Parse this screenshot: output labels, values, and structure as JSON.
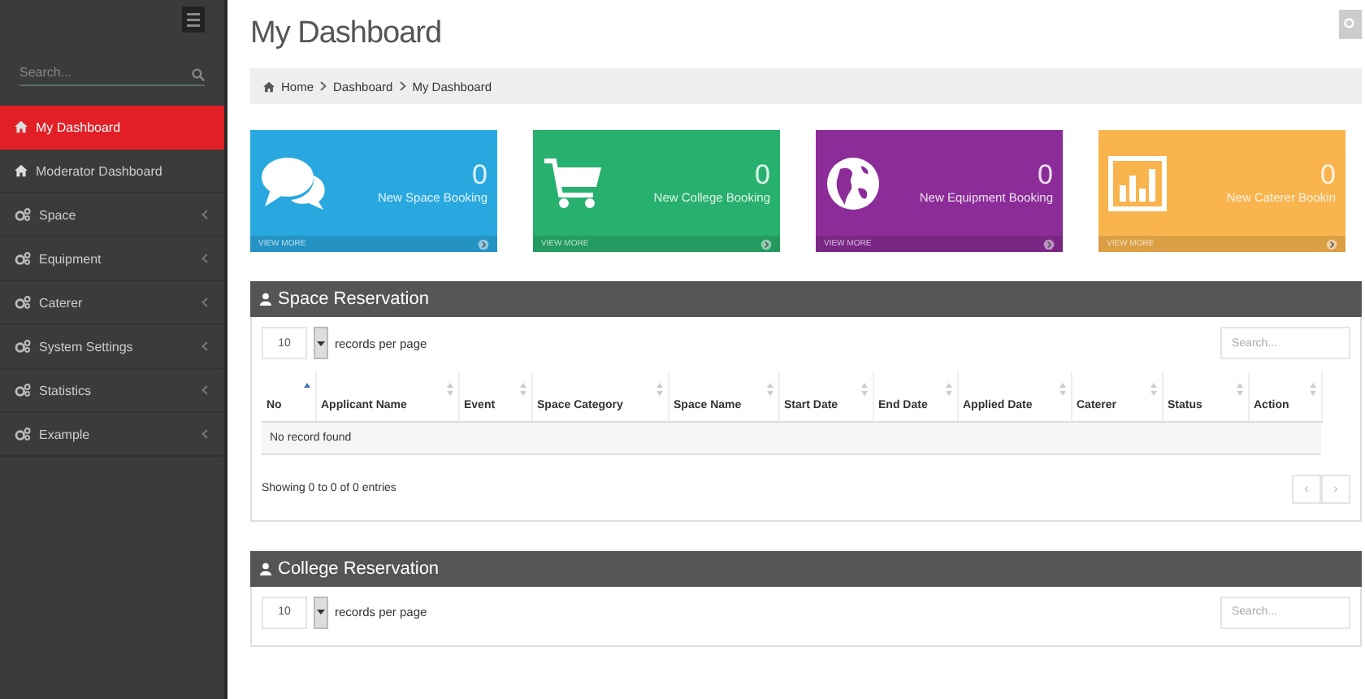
{
  "sidebar": {
    "search_placeholder": "Search...",
    "items": [
      {
        "label": "My Dashboard",
        "kind": "home",
        "selected": true,
        "expandable": false
      },
      {
        "label": "Moderator Dashboard",
        "kind": "home",
        "selected": false,
        "expandable": false
      },
      {
        "label": "Space",
        "kind": "group",
        "selected": false,
        "expandable": true
      },
      {
        "label": "Equipment",
        "kind": "group",
        "selected": false,
        "expandable": true
      },
      {
        "label": "Caterer",
        "kind": "group",
        "selected": false,
        "expandable": true
      },
      {
        "label": "System Settings",
        "kind": "group",
        "selected": false,
        "expandable": true
      },
      {
        "label": "Statistics",
        "kind": "group",
        "selected": false,
        "expandable": true
      },
      {
        "label": "Example",
        "kind": "group",
        "selected": false,
        "expandable": true
      }
    ]
  },
  "page": {
    "title": "My Dashboard",
    "breadcrumb": [
      "Home",
      "Dashboard",
      "My Dashboard"
    ]
  },
  "cards": [
    {
      "kind": "chat",
      "count": "0",
      "label": "New Space Booking",
      "footer": "VIEW MORE",
      "color": "#29a8e0"
    },
    {
      "kind": "cart",
      "count": "0",
      "label": "New College Booking",
      "footer": "VIEW MORE",
      "color": "#27b06e"
    },
    {
      "kind": "globe",
      "count": "0",
      "label": "New Equipment Booking",
      "footer": "VIEW MORE",
      "color": "#8b2c98"
    },
    {
      "kind": "chart",
      "count": "0",
      "label": "New Caterer Bookin",
      "footer": "VIEW MORE",
      "color": "#f9b44d"
    }
  ],
  "panels": [
    {
      "title": "Space Reservation",
      "page_size": "10",
      "length_label": "records per page",
      "search_placeholder": "Search...",
      "columns": [
        {
          "label": "No",
          "sorted": true
        },
        {
          "label": "Applicant Name",
          "sorted": false
        },
        {
          "label": "Event",
          "sorted": false
        },
        {
          "label": "Space Category",
          "sorted": false
        },
        {
          "label": "Space Name",
          "sorted": false
        },
        {
          "label": "Start Date",
          "sorted": false
        },
        {
          "label": "End Date",
          "sorted": false
        },
        {
          "label": "Applied Date",
          "sorted": false
        },
        {
          "label": "Caterer",
          "sorted": false
        },
        {
          "label": "Status",
          "sorted": false
        },
        {
          "label": "Action",
          "sorted": false
        }
      ],
      "empty_text": "No record found",
      "info": "Showing 0 to 0 of 0 entries",
      "pager": [
        "‹",
        "›"
      ]
    },
    {
      "title": "College Reservation",
      "page_size": "10",
      "length_label": "records per page",
      "search_placeholder": "Search..."
    }
  ]
}
